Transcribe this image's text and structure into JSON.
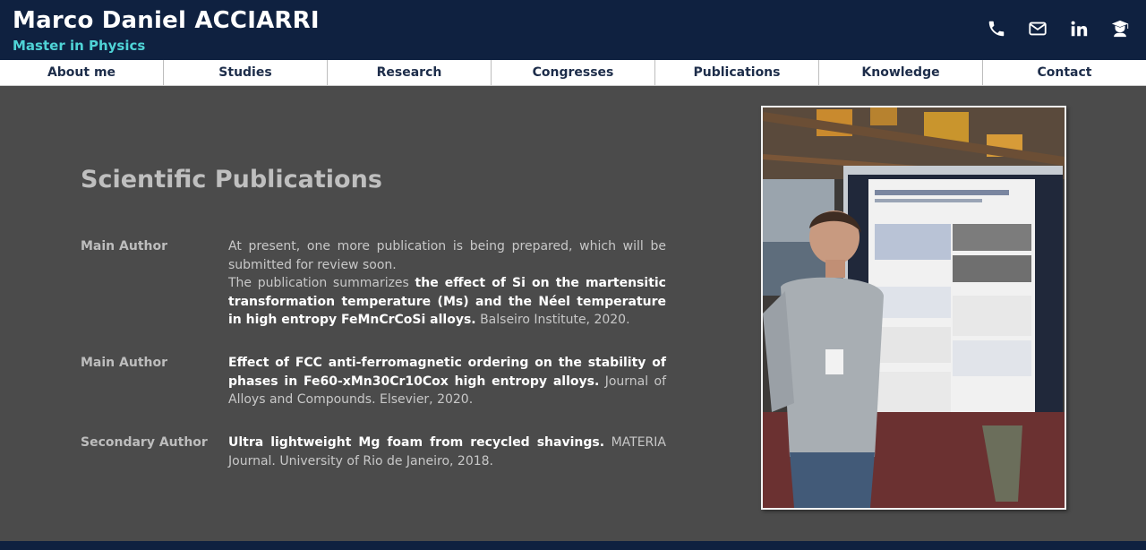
{
  "header": {
    "name": "Marco Daniel ACCIARRI",
    "subtitle": "Master in Physics",
    "icons": [
      "phone-icon",
      "mail-icon",
      "linkedin-icon",
      "graduate-icon"
    ]
  },
  "nav": {
    "items": [
      {
        "label": "About me"
      },
      {
        "label": "Studies"
      },
      {
        "label": "Research"
      },
      {
        "label": "Congresses"
      },
      {
        "label": "Publications"
      },
      {
        "label": "Knowledge"
      },
      {
        "label": "Contact"
      }
    ]
  },
  "main": {
    "title": "Scientific Publications",
    "publications": [
      {
        "role": "Main Author",
        "intro": "At present, one more publication is being prepared, which will be submitted for review soon.",
        "lead": "The publication summarizes",
        "bold": "the effect of Si on the martensitic transformation temperature (Ms) and the Néel temperature in high entropy FeMnCrCoSi alloys.",
        "tail": "Balseiro Institute, 2020."
      },
      {
        "role": "Main Author",
        "bold": "Effect of FCC anti-ferromagnetic ordering on the stability of phases in Fe60-xMn30Cr10Cox high entropy alloys.",
        "tail": "Journal of Alloys and Compounds. Elsevier, 2020."
      },
      {
        "role": "Secondary Author",
        "bold": "Ultra lightweight Mg foam from recycled shavings.",
        "tail": "MATERIA Journal. University of Rio de Janeiro, 2018."
      }
    ]
  },
  "colors": {
    "header_bg": "#0f2140",
    "accent": "#4fd3d6",
    "page_bg": "#4b4b4b",
    "nav_text": "#1d2d4a"
  }
}
